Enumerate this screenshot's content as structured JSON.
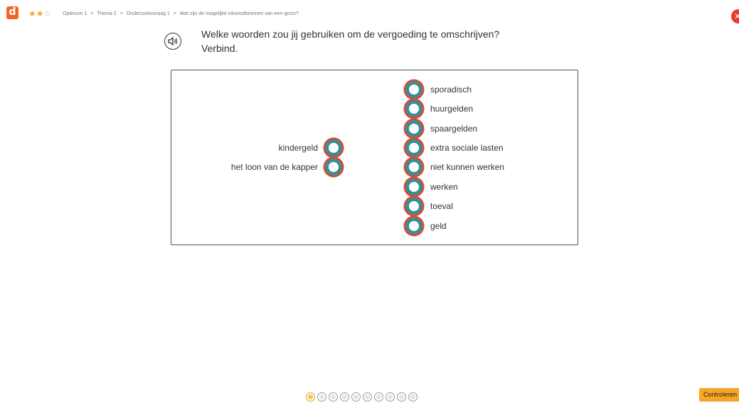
{
  "header": {
    "logo_letter": "d",
    "rating": {
      "filled": 2,
      "total": 3
    },
    "breadcrumb": [
      "Optimum 1",
      ">",
      "Thema 2",
      ">",
      "Onderzoeksvraag 1",
      ">",
      "Wat zijn de mogelijke inkomstbronnen van een gezin?"
    ],
    "close_label": "✕"
  },
  "question": {
    "line1": "Welke woorden zou jij gebruiken om de vergoeding te omschrijven?",
    "line2": "Verbind."
  },
  "left_items": [
    "kindergeld",
    "het loon van de kapper"
  ],
  "right_items": [
    "sporadisch",
    "huurgelden",
    "spaargelden",
    "extra sociale lasten",
    "niet kunnen werken",
    "werken",
    "toeval",
    "geld"
  ],
  "colors": {
    "accent": "#f26522",
    "dot_ring_outer": "#e5472b",
    "dot_ring_inner": "#3a8d95",
    "button": "#f5a623"
  },
  "pager": {
    "count": 10,
    "active_index": 0
  },
  "footer": {
    "check_label": "Controleren"
  }
}
